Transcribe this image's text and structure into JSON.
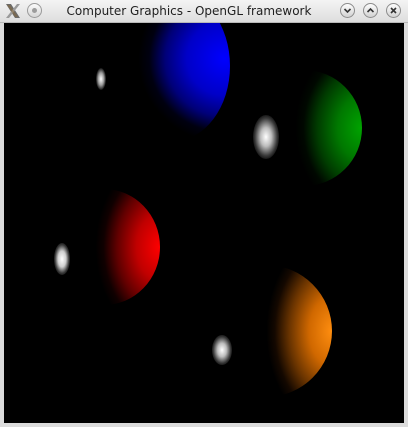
{
  "window": {
    "title": "Computer Graphics - OpenGL framework",
    "app_icon": "x-logo-icon",
    "menu_icon": "window-menu-icon",
    "controls": {
      "minimize_icon": "chevron-down-icon",
      "maximize_icon": "chevron-up-icon",
      "close_icon": "close-icon"
    }
  },
  "scene": {
    "background": "#000000",
    "spheres": [
      {
        "name": "blue-sphere",
        "color": "#0000ff"
      },
      {
        "name": "green-sphere",
        "color": "#00a000"
      },
      {
        "name": "red-sphere",
        "color": "#ff0000"
      },
      {
        "name": "orange-sphere",
        "color": "#ff8800"
      }
    ]
  }
}
